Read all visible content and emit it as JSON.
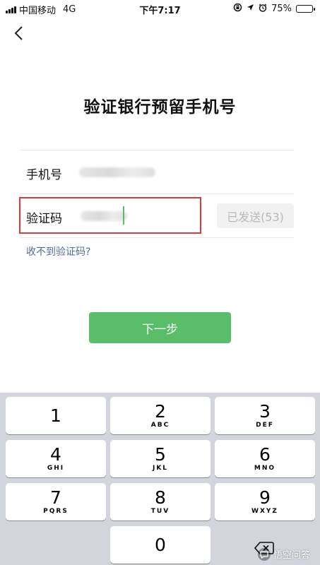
{
  "status_bar": {
    "carrier": "中国移动",
    "network": "4G",
    "time": "下午7:17",
    "battery_percent": "75%",
    "battery_level": 0.75
  },
  "header": {
    "back_icon": "chevron-left-icon"
  },
  "page": {
    "title": "验证银行预留手机号"
  },
  "form": {
    "phone_label": "手机号",
    "code_label": "验证码",
    "resend_label": "已发送(53)",
    "help_link": "收不到验证码?"
  },
  "actions": {
    "next_label": "下一步"
  },
  "keypad": {
    "keys": [
      {
        "digit": "1",
        "letters": ""
      },
      {
        "digit": "2",
        "letters": "ABC"
      },
      {
        "digit": "3",
        "letters": "DEF"
      },
      {
        "digit": "4",
        "letters": "GHI"
      },
      {
        "digit": "5",
        "letters": "JKL"
      },
      {
        "digit": "6",
        "letters": "MNO"
      },
      {
        "digit": "7",
        "letters": "PQRS"
      },
      {
        "digit": "8",
        "letters": "TUV"
      },
      {
        "digit": "9",
        "letters": "WXYZ"
      },
      {
        "digit": "0",
        "letters": ""
      }
    ],
    "delete_icon": "backspace-icon"
  },
  "watermark": {
    "text": "悟空问答"
  },
  "colors": {
    "accent_green": "#59bd6a",
    "highlight_red": "#e0393e",
    "link_blue": "#4e6c98",
    "keypad_bg": "#d2d5db"
  }
}
